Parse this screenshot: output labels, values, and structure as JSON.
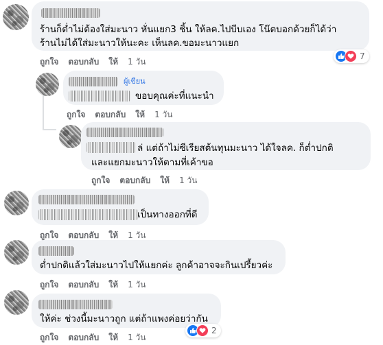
{
  "colors": {
    "bubble": "#f0f2f5",
    "meta": "#65676b",
    "author_badge": "#3578e5",
    "like": "#1877f2",
    "love": "#f33e58"
  },
  "comments": [
    {
      "line1": "ร้านก็ต่ำไม่ต้องใส่มะนาว หั่นแยก3 ชิ้น ให้ลค.ไปบีบเอง โน๊ตบอกด้วยก็ได้ว่า",
      "line2": "ร้านไม่ได้ใส่มะนาวให้นะคะ เห็นลค.ขอมะนาวแยก",
      "like_label": "ถูกใจ",
      "reply_label": "ตอบกลับ",
      "view_label": "ให้",
      "time": "1 วัน",
      "reaction_count": "7"
    },
    {
      "badge": "ผู้เขียน",
      "line1": "ขอบคุณค่ะที่แนะนำ",
      "like_label": "ถูกใจ",
      "reply_label": "ตอบกลับ",
      "view_label": "ให้",
      "time": "1 วัน"
    },
    {
      "line1": "ล่ แต่ถ้าไม่ซีเรียสต้นทุนมะนาว ได้ใจลค. ก็ต่ำปกติ",
      "line2": "และแยกมะนาวให้ตามที่เค้าขอ",
      "like_label": "ถูกใจ",
      "reply_label": "ตอบกลับ",
      "view_label": "ให้",
      "time": "1 วัน"
    },
    {
      "line1": "เป็นทางออกที่ดี",
      "like_label": "ถูกใจ",
      "reply_label": "ตอบกลับ",
      "view_label": "ให้",
      "time": "1 วัน"
    },
    {
      "line1": "ต่ำปกติแล้วใส่มะนาวไปให้แยกค่ะ ลูกค้าอาจจะกินเปรี้ยวค่ะ",
      "like_label": "ถูกใจ",
      "reply_label": "ตอบกลับ",
      "view_label": "ให้",
      "time": "1 วัน"
    },
    {
      "line1": "ให้ค่ะ ช่วงนี้มะนาวถูก แต่ถ้าแพงค่อยว่ากัน",
      "like_label": "ถูกใจ",
      "reply_label": "ตอบกลับ",
      "view_label": "ให้",
      "time": "1 วัน",
      "reaction_count": "2"
    }
  ]
}
